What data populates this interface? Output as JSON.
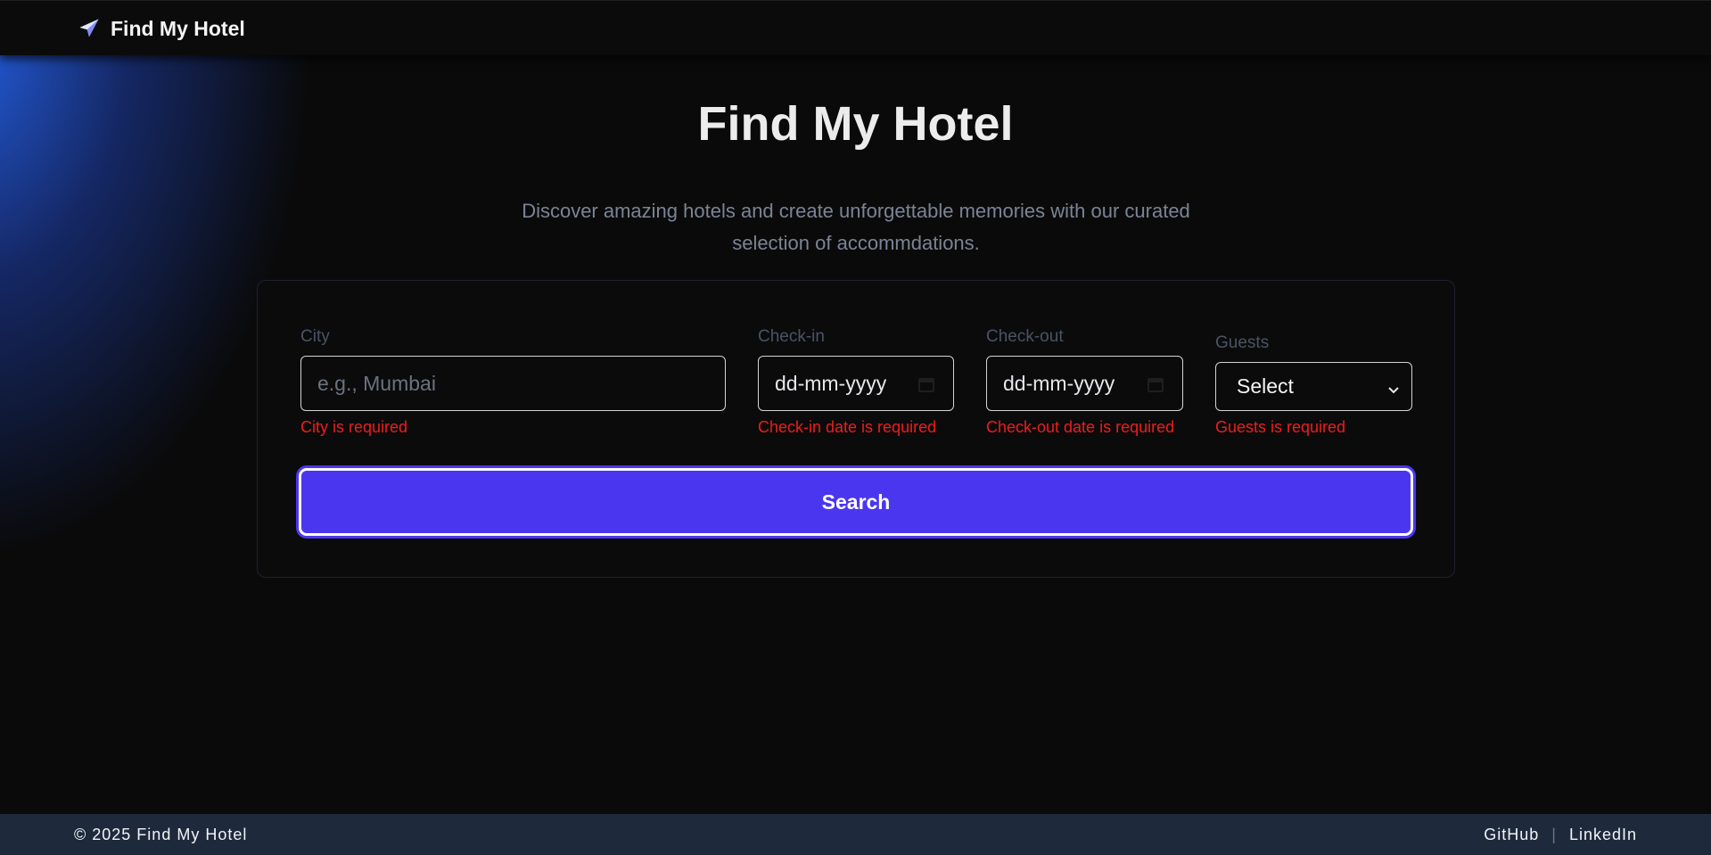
{
  "navbar": {
    "brand": "Find My Hotel",
    "brand_icon": "airplane-icon"
  },
  "hero": {
    "title": "Find My Hotel",
    "subtitle": "Discover amazing hotels and create unforgettable memories with our curated selection of accommdations."
  },
  "form": {
    "city": {
      "label": "City",
      "placeholder": "e.g., Mumbai",
      "value": "",
      "error": "City is required"
    },
    "checkin": {
      "label": "Check-in",
      "value": "dd-mm-yyyy",
      "error": "Check-in date is required"
    },
    "checkout": {
      "label": "Check-out",
      "value": "dd-mm-yyyy",
      "error": "Check-out date is required"
    },
    "guests": {
      "label": "Guests",
      "value": "Select",
      "error": "Guests is required"
    },
    "search_label": "Search"
  },
  "footer": {
    "copyright": "© 2025 Find My Hotel",
    "github": "GitHub",
    "separator": "|",
    "linkedin": "LinkedIn"
  },
  "colors": {
    "accent": "#4b36f0",
    "error": "#ef1c1c",
    "footer_bg": "#1e293b",
    "glow": "#2563eb"
  }
}
